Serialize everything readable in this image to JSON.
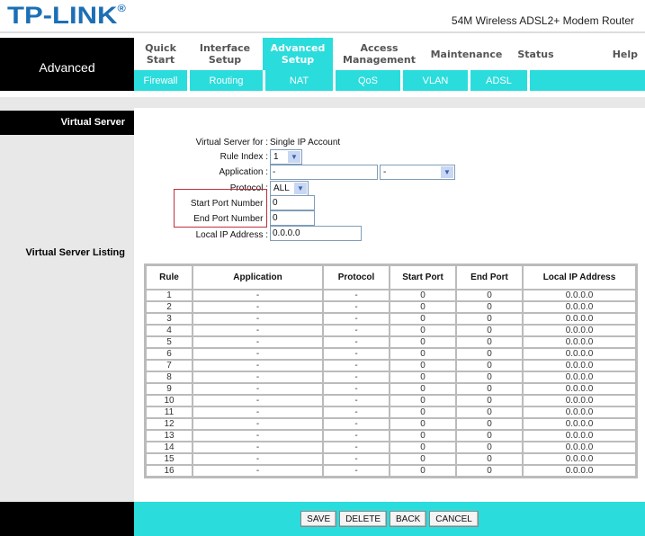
{
  "header": {
    "logo": "TP-LINK",
    "logo_mark": "®",
    "product": "54M Wireless ADSL2+ Modem Router",
    "section": "Advanced"
  },
  "nav": [
    {
      "label": "Quick\nStart",
      "active": false
    },
    {
      "label": "Interface\nSetup",
      "active": false
    },
    {
      "label": "Advanced\nSetup",
      "active": true
    },
    {
      "label": "Access\nManagement",
      "active": false
    },
    {
      "label": "Maintenance",
      "active": false
    },
    {
      "label": "Status",
      "active": false
    },
    {
      "label": "Help",
      "active": false
    }
  ],
  "subnav": [
    "Firewall",
    "Routing",
    "NAT",
    "QoS",
    "VLAN",
    "ADSL"
  ],
  "sidebar": {
    "heading": "Virtual Server",
    "listing_label": "Virtual Server Listing"
  },
  "form": {
    "virtual_server_for_label": "Virtual Server for :",
    "virtual_server_for_value": "Single IP Account",
    "rule_index_label": "Rule Index :",
    "rule_index_value": "1",
    "application_label": "Application :",
    "application_value": "-",
    "application_select_value": "-",
    "protocol_label": "Protocol :",
    "protocol_value": "ALL",
    "start_port_label": "Start Port Number :",
    "start_port_value": "0",
    "end_port_label": "End Port Number :",
    "end_port_value": "0",
    "local_ip_label": "Local IP Address :",
    "local_ip_value": "0.0.0.0"
  },
  "table": {
    "headers": [
      "Rule",
      "Application",
      "Protocol",
      "Start Port",
      "End Port",
      "Local IP Address"
    ],
    "rows": [
      [
        "1",
        "-",
        "-",
        "0",
        "0",
        "0.0.0.0"
      ],
      [
        "2",
        "-",
        "-",
        "0",
        "0",
        "0.0.0.0"
      ],
      [
        "3",
        "-",
        "-",
        "0",
        "0",
        "0.0.0.0"
      ],
      [
        "4",
        "-",
        "-",
        "0",
        "0",
        "0.0.0.0"
      ],
      [
        "5",
        "-",
        "-",
        "0",
        "0",
        "0.0.0.0"
      ],
      [
        "6",
        "-",
        "-",
        "0",
        "0",
        "0.0.0.0"
      ],
      [
        "7",
        "-",
        "-",
        "0",
        "0",
        "0.0.0.0"
      ],
      [
        "8",
        "-",
        "-",
        "0",
        "0",
        "0.0.0.0"
      ],
      [
        "9",
        "-",
        "-",
        "0",
        "0",
        "0.0.0.0"
      ],
      [
        "10",
        "-",
        "-",
        "0",
        "0",
        "0.0.0.0"
      ],
      [
        "11",
        "-",
        "-",
        "0",
        "0",
        "0.0.0.0"
      ],
      [
        "12",
        "-",
        "-",
        "0",
        "0",
        "0.0.0.0"
      ],
      [
        "13",
        "-",
        "-",
        "0",
        "0",
        "0.0.0.0"
      ],
      [
        "14",
        "-",
        "-",
        "0",
        "0",
        "0.0.0.0"
      ],
      [
        "15",
        "-",
        "-",
        "0",
        "0",
        "0.0.0.0"
      ],
      [
        "16",
        "-",
        "-",
        "0",
        "0",
        "0.0.0.0"
      ]
    ]
  },
  "buttons": {
    "save": "SAVE",
    "delete": "DELETE",
    "back": "BACK",
    "cancel": "CANCEL"
  },
  "icons": {
    "dropdown": "▼"
  },
  "colors": {
    "accent": "#2bdcdc",
    "logo": "#1b6fb5",
    "highlight": "#c0303a"
  }
}
